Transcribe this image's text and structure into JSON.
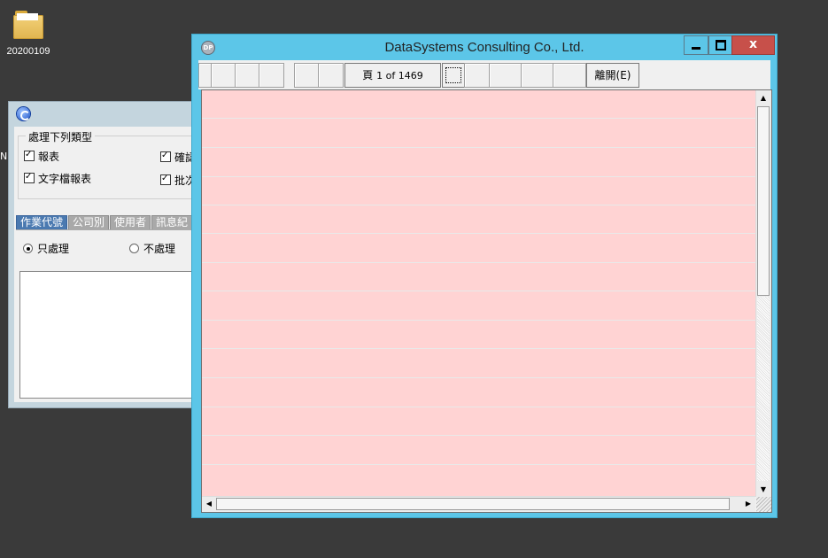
{
  "desktop": {
    "folder_label": "20200109",
    "edge_char": "N"
  },
  "bg_dialog": {
    "group_title": "處理下列類型",
    "checkboxes": [
      {
        "label": "報表",
        "checked": true
      },
      {
        "label": "文字檔報表",
        "checked": true
      },
      {
        "label": "確認",
        "checked": true
      },
      {
        "label": "批次",
        "checked": true
      }
    ],
    "tabs": [
      "作業代號",
      "公司別",
      "使用者",
      "訊息紀"
    ],
    "active_tab": "作業代號",
    "radios": [
      {
        "label": "只處理",
        "selected": true
      },
      {
        "label": "不處理",
        "selected": false
      }
    ]
  },
  "main_window": {
    "title": "DataSystems  Consulting Co., Ltd.",
    "sys_icon_text": "DP",
    "close_label": "x",
    "toolbar": {
      "page_prefix": "頁",
      "page_text": "1 of 1469",
      "exit_label": "離開(E)"
    },
    "accent_colors": {
      "window_frame": "#5cc6e8",
      "report_background": "#ffd3d3",
      "close_button": "#c7504a"
    },
    "report_rows": 14,
    "scroll": {
      "vertical_position": 0.0,
      "up_arrow": "▲",
      "down_arrow": "▼",
      "left_arrow": "◀",
      "right_arrow": "▶"
    }
  }
}
